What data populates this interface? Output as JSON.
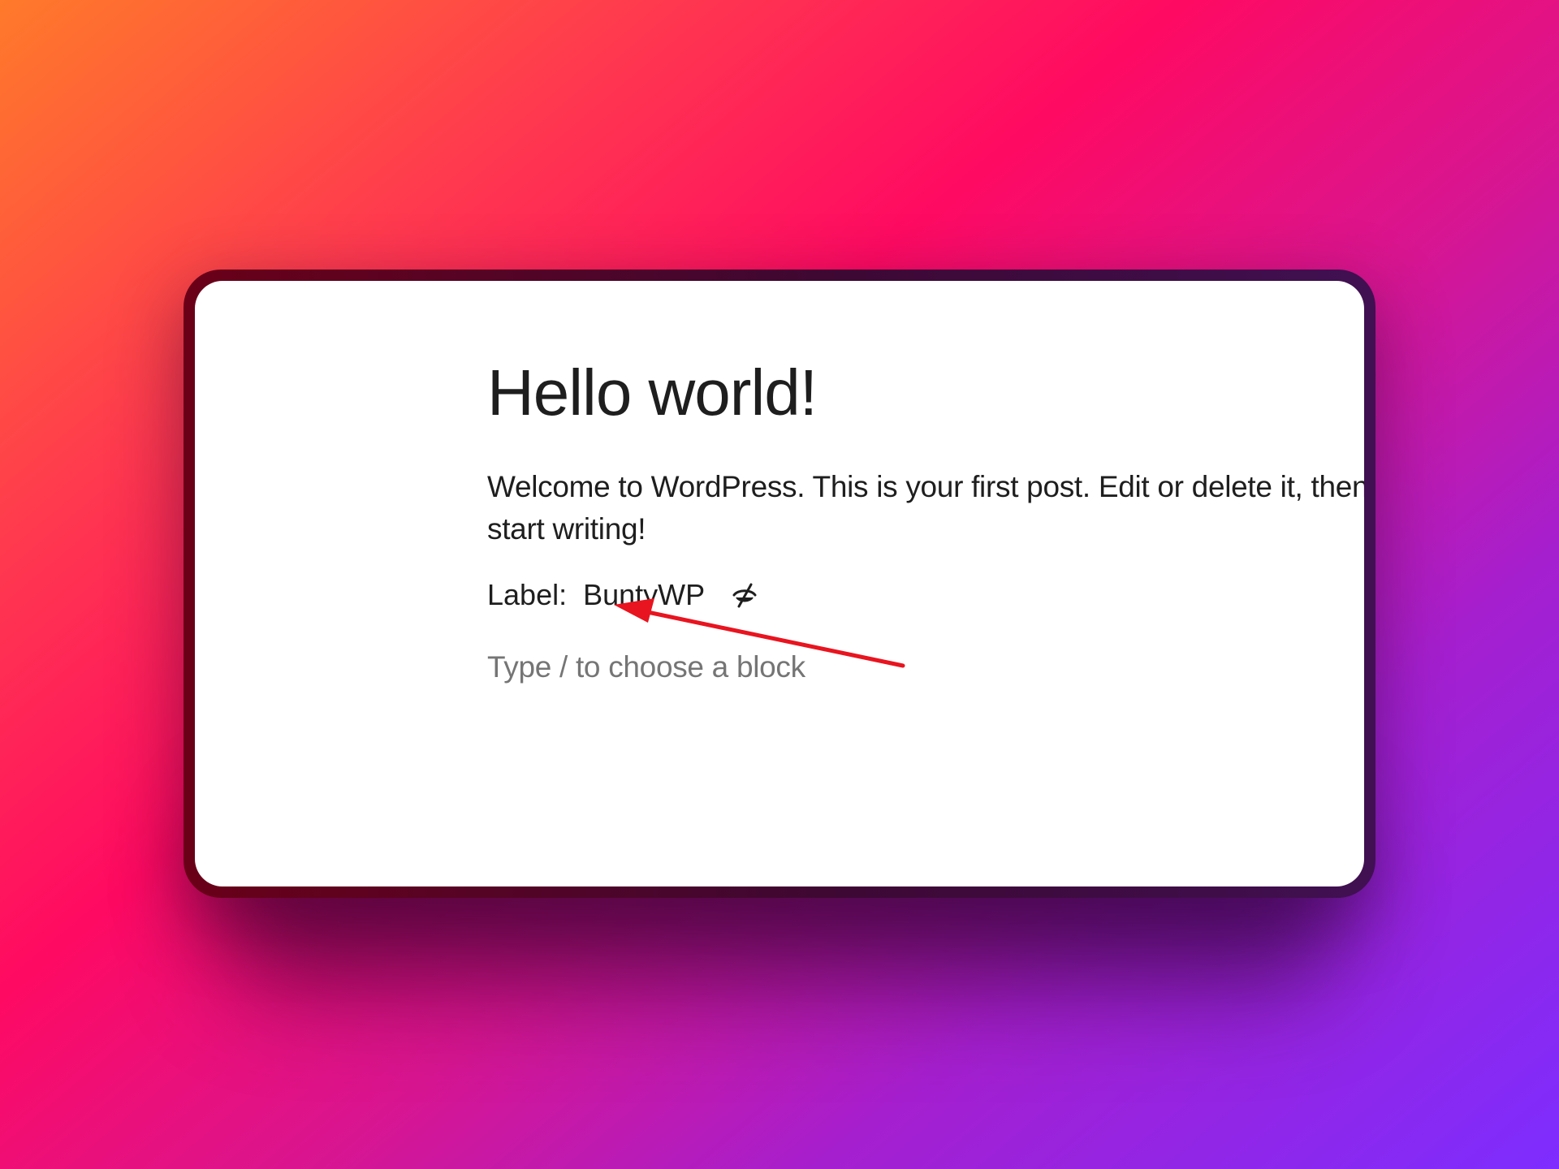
{
  "post": {
    "title": "Hello world!",
    "paragraph": "Welcome to WordPress. This is your first post. Edit or delete it, then start writing!",
    "label_key": "Label",
    "label_colon": ":",
    "label_value": "BuntyWP",
    "block_placeholder": "Type / to choose a block"
  },
  "icons": {
    "label_visibility": "eye-slash-icon"
  },
  "colors": {
    "annotation_arrow": "#e8141f",
    "text": "#1e1e1e",
    "placeholder": "#757575"
  }
}
